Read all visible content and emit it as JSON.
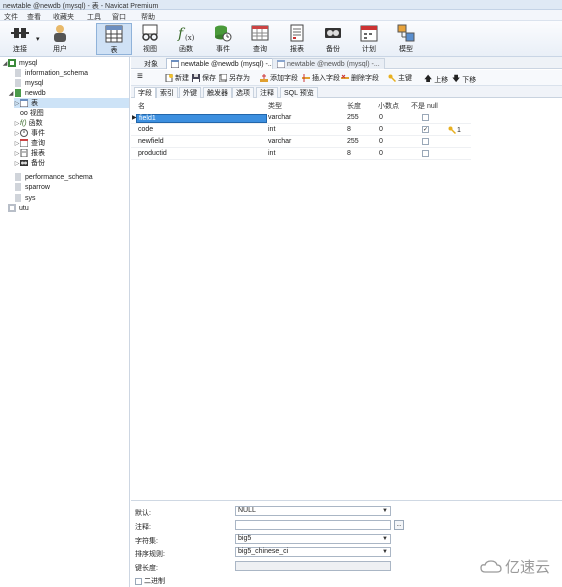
{
  "window": {
    "title": "newtable @newdb (mysql) - 表 - Navicat Premium"
  },
  "menu": [
    "文件",
    "查看",
    "收藏夹",
    "工具",
    "窗口",
    "帮助"
  ],
  "toolbar": {
    "buttons": [
      {
        "label": "连接",
        "icon": "plug-icon"
      },
      {
        "label": "用户",
        "icon": "user-icon"
      },
      {
        "label": "表",
        "icon": "table-icon"
      },
      {
        "label": "视图",
        "icon": "glasses-icon"
      },
      {
        "label": "函数",
        "icon": "function-icon"
      },
      {
        "label": "事件",
        "icon": "event-icon"
      },
      {
        "label": "查询",
        "icon": "query-icon"
      },
      {
        "label": "报表",
        "icon": "report-icon"
      },
      {
        "label": "备份",
        "icon": "backup-icon"
      },
      {
        "label": "计划",
        "icon": "calendar-icon"
      },
      {
        "label": "模型",
        "icon": "model-icon"
      }
    ]
  },
  "tree": {
    "items": [
      {
        "label": "mysql",
        "level": 0,
        "expanded": true
      },
      {
        "label": "information_schema",
        "level": 1
      },
      {
        "label": "mysql",
        "level": 1
      },
      {
        "label": "newdb",
        "level": 1,
        "expanded": true
      },
      {
        "label": "表",
        "level": 2,
        "selected": true
      },
      {
        "label": "视图",
        "level": 2
      },
      {
        "label": "函数",
        "level": 2
      },
      {
        "label": "事件",
        "level": 2
      },
      {
        "label": "查询",
        "level": 2
      },
      {
        "label": "报表",
        "level": 2
      },
      {
        "label": "备份",
        "level": 2
      },
      {
        "label": "performance_schema",
        "level": 1
      },
      {
        "label": "sparrow",
        "level": 1
      },
      {
        "label": "sys",
        "level": 1
      },
      {
        "label": "utu",
        "level": 0
      }
    ]
  },
  "tabs": [
    {
      "label": "对象"
    },
    {
      "label": "newtable @newdb (mysql) -..."
    },
    {
      "label": "newtable @newdb (mysql) -..."
    }
  ],
  "actions": {
    "new": "新建",
    "save": "保存",
    "save_as": "另存为",
    "add_field": "添加字段",
    "insert_field": "插入字段",
    "delete_field": "删除字段",
    "primary_key": "主键",
    "move_up": "上移",
    "move_down": "下移"
  },
  "subtabs": [
    "字段",
    "索引",
    "外键",
    "触发器",
    "选项",
    "注释",
    "SQL 预览"
  ],
  "grid": {
    "headers": [
      "名",
      "类型",
      "长度",
      "小数点",
      "不是 null"
    ],
    "rows": [
      {
        "name": "field1",
        "type": "varchar",
        "length": "255",
        "decimals": "0",
        "not_null": false,
        "key": ""
      },
      {
        "name": "code",
        "type": "int",
        "length": "8",
        "decimals": "0",
        "not_null": true,
        "key": "1"
      },
      {
        "name": "newfield",
        "type": "varchar",
        "length": "255",
        "decimals": "0",
        "not_null": false,
        "key": ""
      },
      {
        "name": "productid",
        "type": "int",
        "length": "8",
        "decimals": "0",
        "not_null": false,
        "key": ""
      }
    ]
  },
  "props": {
    "default_label": "默认:",
    "default_value": "NULL",
    "comment_label": "注释:",
    "charset_label": "字符集:",
    "charset_value": "big5",
    "collation_label": "排序规则:",
    "collation_value": "big5_chinese_ci",
    "key_length_label": "键长度:",
    "binary_label": "二进制"
  },
  "watermark": "亿速云"
}
